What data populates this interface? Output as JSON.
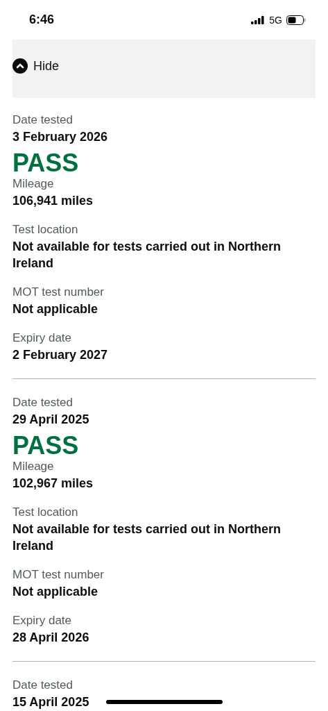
{
  "status_bar": {
    "time": "6:46",
    "network": "5G"
  },
  "details": {
    "toggle": "Hide",
    "expanded": true
  },
  "tests": [
    {
      "fields": [
        {
          "kind": "date",
          "label": "Date tested",
          "value": "3 February 2026"
        },
        {
          "kind": "result",
          "value": "PASS"
        },
        {
          "kind": "field",
          "label": "Mileage",
          "value": "106,941 miles"
        },
        {
          "kind": "field",
          "label": "Test location",
          "value": "Not available for tests carried out in Northern Ireland"
        },
        {
          "kind": "field",
          "label": "MOT test number",
          "value": "Not applicable"
        },
        {
          "kind": "field",
          "label": "Expiry date",
          "value": "2 February 2027"
        }
      ]
    },
    {
      "fields": [
        {
          "kind": "date",
          "label": "Date tested",
          "value": "29 April 2025"
        },
        {
          "kind": "result",
          "value": "PASS"
        },
        {
          "kind": "field",
          "label": "Mileage",
          "value": "102,967 miles"
        },
        {
          "kind": "field",
          "label": "Test location",
          "value": "Not available for tests carried out in Northern Ireland"
        },
        {
          "kind": "field",
          "label": "MOT test number",
          "value": "Not applicable"
        },
        {
          "kind": "field",
          "label": "Expiry date",
          "value": "28 April 2026"
        }
      ]
    },
    {
      "fields": [
        {
          "kind": "date",
          "label": "Date tested",
          "value": "15 April 2025"
        }
      ]
    }
  ]
}
